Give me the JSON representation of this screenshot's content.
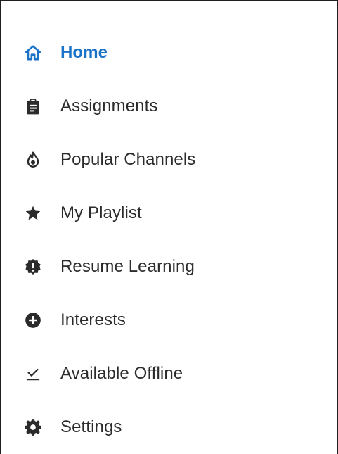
{
  "colors": {
    "active": "#1a73c9",
    "text": "#2b2b2b",
    "icon": "#2b2b2b",
    "background": "#ffffff",
    "border": "#1f1f1f"
  },
  "menu": {
    "items": [
      {
        "id": "home",
        "label": "Home",
        "icon": "home-icon",
        "active": true
      },
      {
        "id": "assignments",
        "label": "Assignments",
        "icon": "clipboard-icon",
        "active": false
      },
      {
        "id": "popular-channels",
        "label": "Popular Channels",
        "icon": "fire-icon",
        "active": false
      },
      {
        "id": "my-playlist",
        "label": "My Playlist",
        "icon": "star-icon",
        "active": false
      },
      {
        "id": "resume-learning",
        "label": "Resume Learning",
        "icon": "alert-badge-icon",
        "active": false
      },
      {
        "id": "interests",
        "label": "Interests",
        "icon": "plus-circle-icon",
        "active": false
      },
      {
        "id": "available-offline",
        "label": "Available Offline",
        "icon": "download-check-icon",
        "active": false
      },
      {
        "id": "settings",
        "label": "Settings",
        "icon": "gear-icon",
        "active": false
      }
    ]
  }
}
